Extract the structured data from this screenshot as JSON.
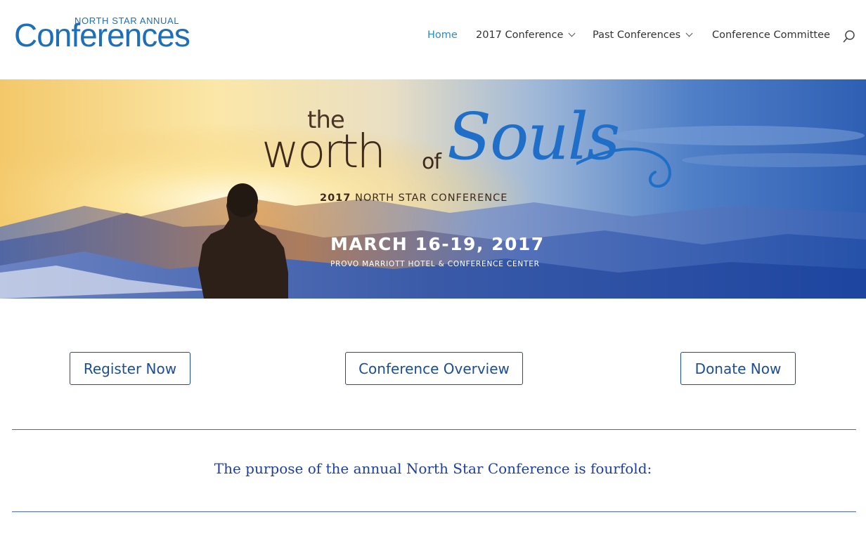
{
  "logo": {
    "small_text": "NORTH STAR ANNUAL",
    "big_text": "Conferences"
  },
  "nav": {
    "items": [
      {
        "label": "Home",
        "active": true,
        "has_dropdown": false
      },
      {
        "label": "2017 Conference",
        "active": false,
        "has_dropdown": true
      },
      {
        "label": "Past Conferences",
        "active": false,
        "has_dropdown": true
      },
      {
        "label": "Conference Committee",
        "active": false,
        "has_dropdown": false
      }
    ],
    "search_icon": "search-icon"
  },
  "banner": {
    "title_the": "the",
    "title_worth": "worth",
    "title_of": "of",
    "title_souls": "Souls",
    "year": "2017",
    "conference_name": "NORTH STAR CONFERENCE",
    "dates": "MARCH 16-19, 2017",
    "venue": "PROVO MARRIOTT HOTEL & CONFERENCE CENTER"
  },
  "buttons": {
    "register": "Register Now",
    "overview": "Conference Overview",
    "donate": "Donate Now"
  },
  "purpose_text": "The purpose of the annual North Star Conference is fourfold:",
  "colors": {
    "nav_active": "#2a8ec2",
    "brand_blue": "#1d6fb8",
    "button_border": "#1b4d9a",
    "heading_blue": "#1f3fa0"
  }
}
